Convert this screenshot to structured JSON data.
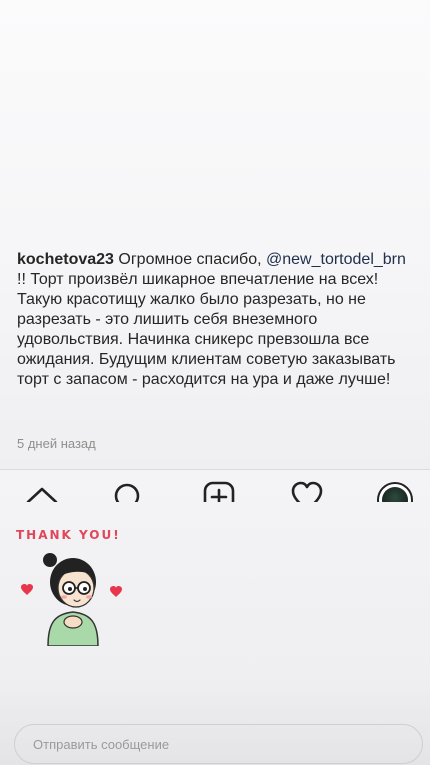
{
  "comment": {
    "username": "kochetova23",
    "text_before_mention": "Огромное спасибо,",
    "mention": "@new_tortodel_brn",
    "text_after_mention": "!! Торт произвёл шикарное впечатление на всех! Такую красотищу жалко было разрезать, но не разрезать - это лишить себя внеземного удовольствия. Начинка сникерс превзошла все ожидания. Будущим клиентам советую заказывать торт с запасом - расходится на ура и даже лучше!",
    "timestamp": "5 дней назад"
  },
  "tabbar": {
    "icons": [
      "home-icon",
      "search-icon",
      "new-post-icon",
      "activity-icon",
      "profile-avatar"
    ]
  },
  "sticker": {
    "title": "THANK YOU!",
    "icon": "thank-you-girl-sticker"
  },
  "reply": {
    "placeholder": "Отправить сообщение"
  },
  "colors": {
    "sticker_accent": "#e0475a",
    "text": "#262626",
    "muted": "#8e8e8e"
  }
}
